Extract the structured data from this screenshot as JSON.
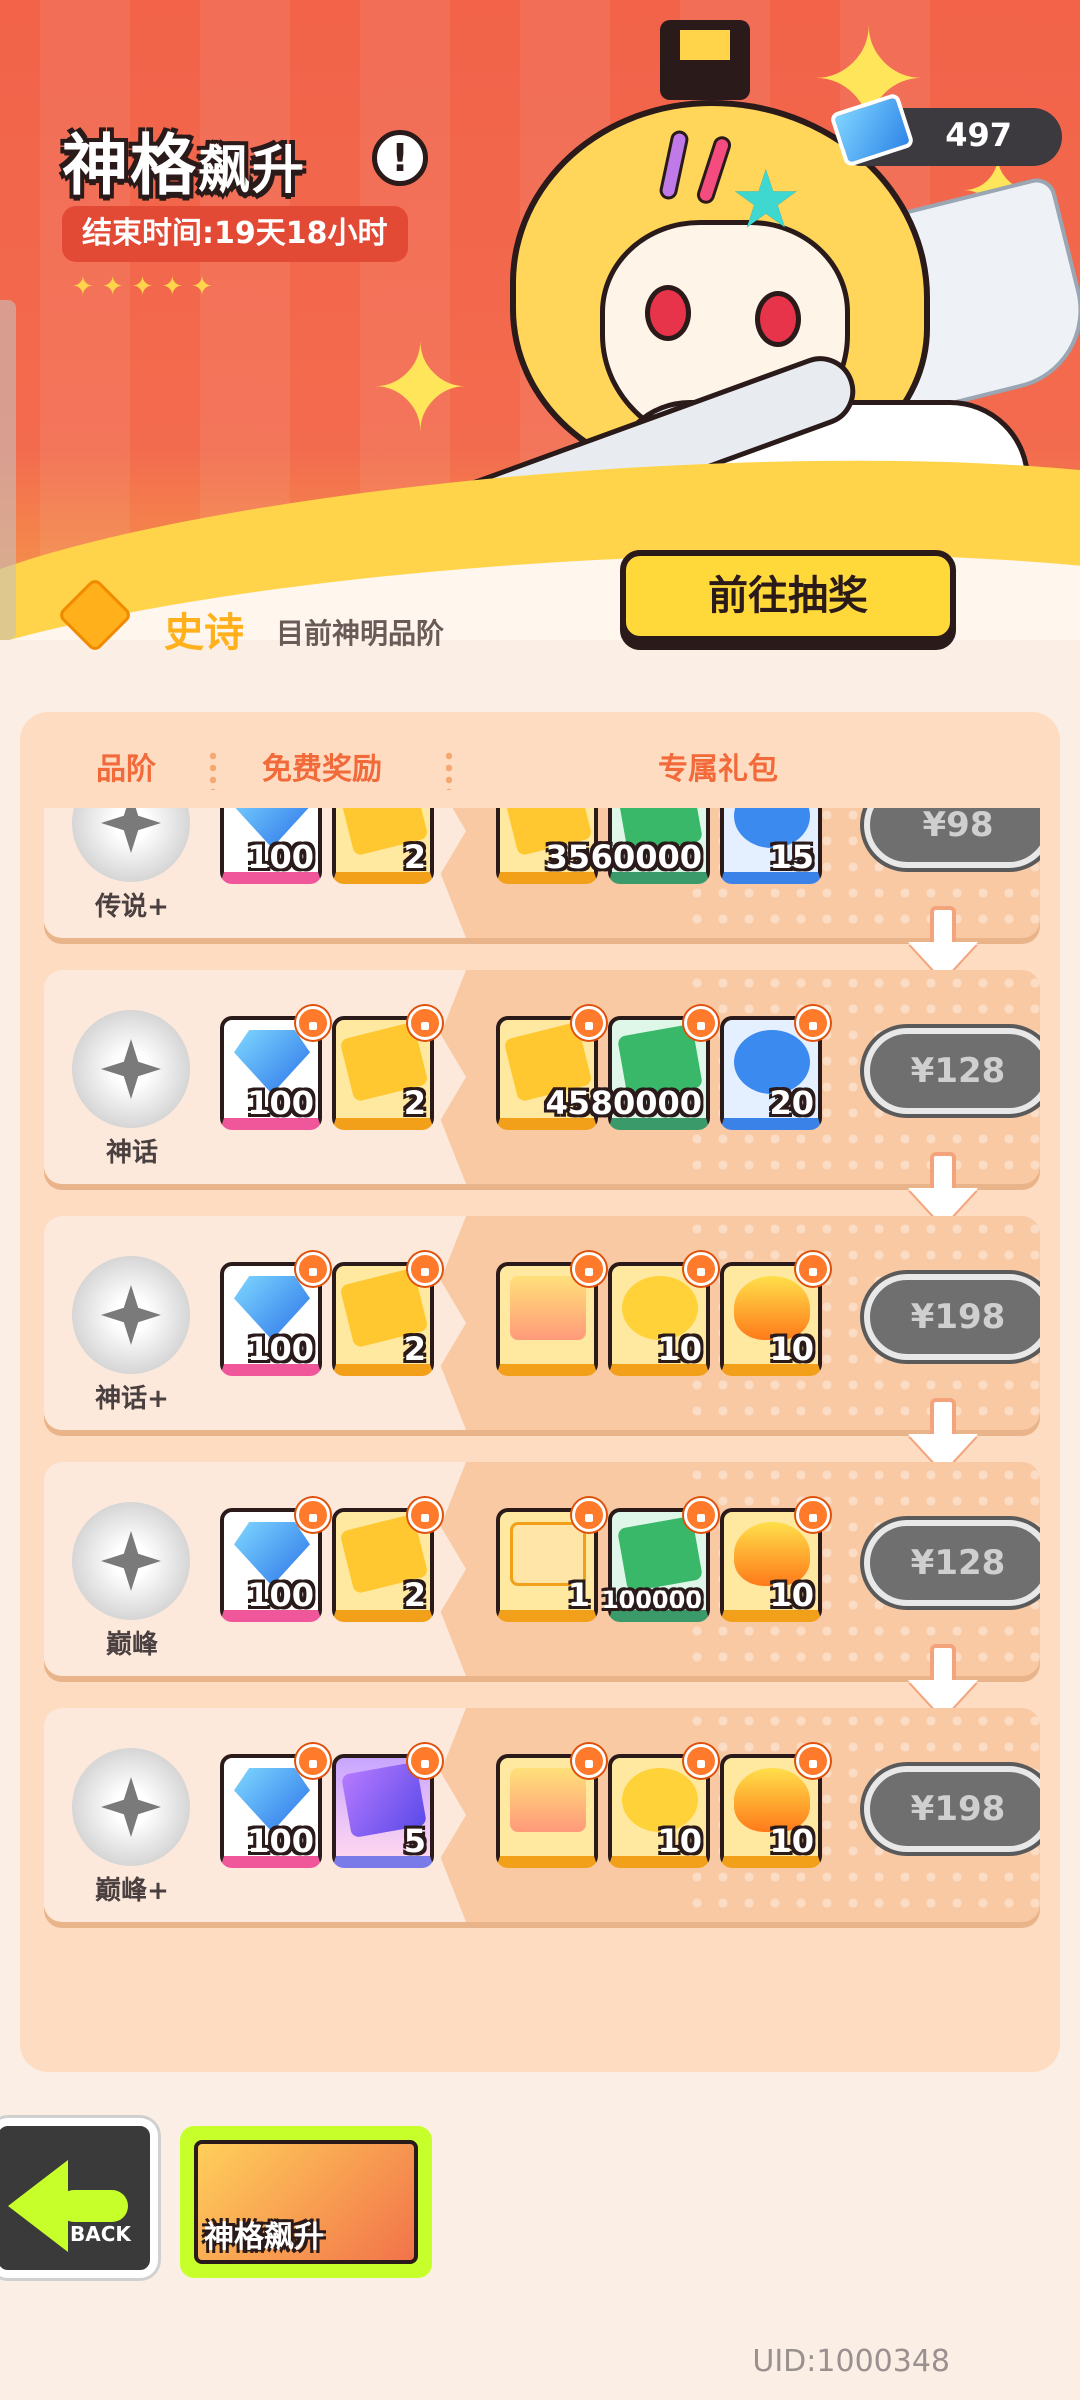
{
  "header": {
    "title_big": "神格",
    "title_small": "飙升",
    "end_time": "结束时间:19天18小时",
    "stars": "✦✦✦✦✦",
    "currency_amount": "497",
    "go_draw_label": "前往抽奖"
  },
  "current_rank": {
    "name": "史诗",
    "desc": "目前神明品阶"
  },
  "table": {
    "col_rank": "品阶",
    "col_free": "免费奖励",
    "col_exclusive": "专属礼包"
  },
  "rows": [
    {
      "rank": "传说+",
      "free": [
        {
          "icon": "diamond-icon",
          "qty": "100"
        },
        {
          "icon": "ticket-icon",
          "qty": "2"
        }
      ],
      "exclusive": [
        {
          "icon": "ticket-icon",
          "qty": "35"
        },
        {
          "icon": "cash-icon",
          "qty": "60000"
        },
        {
          "icon": "film-reel-icon",
          "qty": "15"
        }
      ],
      "price": "¥98"
    },
    {
      "rank": "神话",
      "free": [
        {
          "icon": "diamond-icon",
          "qty": "100"
        },
        {
          "icon": "ticket-icon",
          "qty": "2"
        }
      ],
      "exclusive": [
        {
          "icon": "ticket-icon",
          "qty": "45"
        },
        {
          "icon": "cash-icon",
          "qty": "80000"
        },
        {
          "icon": "film-reel-icon",
          "qty": "20"
        }
      ],
      "price": "¥128"
    },
    {
      "rank": "神话+",
      "free": [
        {
          "icon": "diamond-icon",
          "qty": "100"
        },
        {
          "icon": "ticket-icon",
          "qty": "2"
        }
      ],
      "exclusive": [
        {
          "icon": "avatar-card-icon",
          "qty": ""
        },
        {
          "icon": "coin-card-icon",
          "qty": "10"
        },
        {
          "icon": "fire-icon",
          "qty": "10"
        }
      ],
      "price": "¥198"
    },
    {
      "rank": "巅峰",
      "free": [
        {
          "icon": "diamond-icon",
          "qty": "100"
        },
        {
          "icon": "ticket-icon",
          "qty": "2"
        }
      ],
      "exclusive": [
        {
          "icon": "avatar-frame-icon",
          "qty": "1"
        },
        {
          "icon": "cash-icon",
          "qty": "100000"
        },
        {
          "icon": "fire-icon",
          "qty": "10"
        }
      ],
      "price": "¥128"
    },
    {
      "rank": "巅峰+",
      "free": [
        {
          "icon": "diamond-icon",
          "qty": "100"
        },
        {
          "icon": "film-ticket-icon",
          "qty": "5"
        }
      ],
      "exclusive": [
        {
          "icon": "avatar-card-icon",
          "qty": ""
        },
        {
          "icon": "coin-card-icon",
          "qty": "10"
        },
        {
          "icon": "fire-icon",
          "qty": "10"
        }
      ],
      "price": "¥198"
    }
  ],
  "bottom": {
    "back_label": "BACK",
    "event_tab_label": "神格飙升",
    "uid": "UID:1000348"
  },
  "colors": {
    "banner": "#f2634a",
    "accent_yellow": "#ffd93a",
    "rank_gold": "#ffb01a",
    "header_orange": "#f26a3a",
    "price_disabled": "#6f6f6f",
    "back_accent": "#c6ff2a"
  }
}
